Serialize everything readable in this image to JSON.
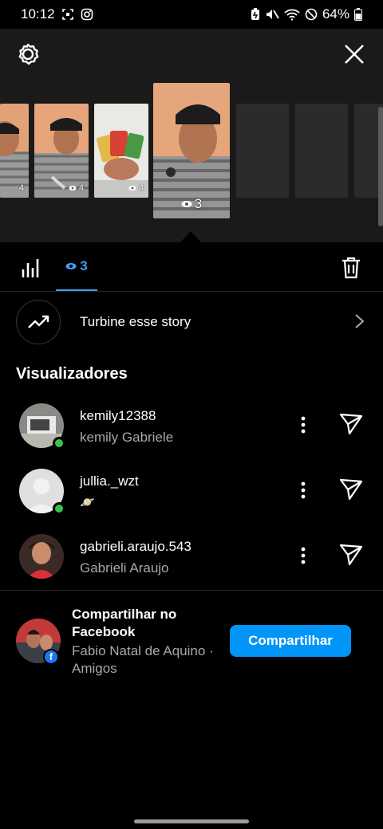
{
  "status_bar": {
    "time": "10:12",
    "battery": "64%",
    "icons": [
      "screenshot-icon",
      "instagram-icon",
      "battery-saver-icon",
      "mute-icon",
      "wifi-icon",
      "do-not-disturb-icon",
      "battery-icon"
    ]
  },
  "gallery": {
    "thumbnails": [
      {
        "views": "4"
      },
      {
        "views": "4"
      },
      {
        "views": "4"
      },
      {
        "views": "3",
        "selected": true
      }
    ]
  },
  "tabs": {
    "views_count": "3"
  },
  "boost": {
    "label": "Turbine esse story"
  },
  "viewers_title": "Visualizadores",
  "viewers": [
    {
      "username": "kemily12388",
      "name": "kemily Gabriele",
      "online": true
    },
    {
      "username": "jullia._wzt",
      "name": "🪐",
      "online": true
    },
    {
      "username": "gabrieli.araujo.543",
      "name": "Gabrieli Araujo",
      "online": false
    }
  ],
  "share": {
    "title": "Compartilhar no Facebook",
    "subtitle": "Fabio Natal de Aquino · Amigos",
    "button": "Compartilhar",
    "badge": "f"
  },
  "colors": {
    "accent": "#3d9df2",
    "button": "#0095f6",
    "online": "#38c24a",
    "facebook": "#1877f2"
  }
}
